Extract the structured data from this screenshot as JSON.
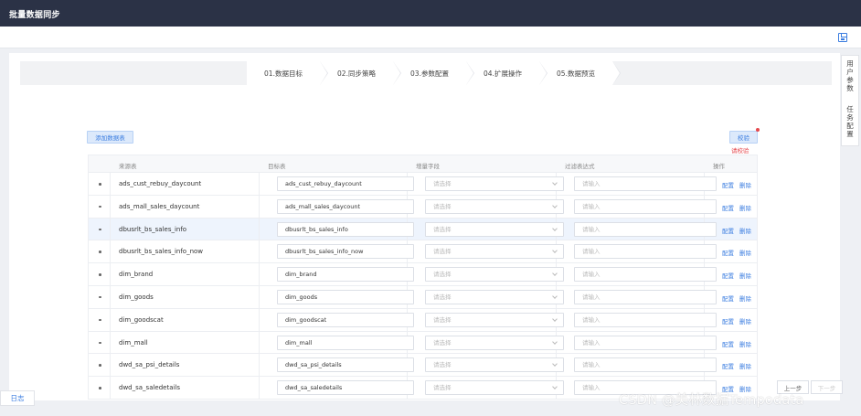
{
  "header": {
    "title": "批量数据同步"
  },
  "steps": [
    "01.数据目标",
    "02.同步策略",
    "03.参数配置",
    "04.扩展操作",
    "05.数据预览"
  ],
  "toolbar": {
    "add_label": "添加数据表",
    "check_label": "校验",
    "check_warning": "请校验"
  },
  "table": {
    "headers": {
      "source": "来源表",
      "target": "目标表",
      "increment": "增量字段",
      "filter": "过滤表达式",
      "ops": "操作"
    },
    "select_placeholder": "请选择",
    "input_placeholder": "请输入",
    "op_config": "配置",
    "op_delete": "删除",
    "rows": [
      {
        "source": "ads_cust_rebuy_daycount",
        "target": "ads_cust_rebuy_daycount"
      },
      {
        "source": "ads_mall_sales_daycount",
        "target": "ads_mall_sales_daycount"
      },
      {
        "source": "dbusrlt_bs_sales_info",
        "target": "dbusrlt_bs_sales_info"
      },
      {
        "source": "dbusrlt_bs_sales_info_now",
        "target": "dbusrlt_bs_sales_info_now"
      },
      {
        "source": "dim_brand",
        "target": "dim_brand"
      },
      {
        "source": "dim_goods",
        "target": "dim_goods"
      },
      {
        "source": "dim_goodscat",
        "target": "dim_goodscat"
      },
      {
        "source": "dim_mall",
        "target": "dim_mall"
      },
      {
        "source": "dwd_sa_psi_details",
        "target": "dwd_sa_psi_details"
      },
      {
        "source": "dwd_sa_saledetails",
        "target": "dwd_sa_saledetails"
      }
    ]
  },
  "right_tabs": [
    "用户参数",
    "任务配置"
  ],
  "log_tab": "日志",
  "pager": {
    "prev": "上一步",
    "next": "下一步"
  },
  "watermark": "CSDN @美林数据Tempodata",
  "colors": {
    "topbar": "#2b3246",
    "accent": "#3b7de0",
    "warning": "#e5484d"
  }
}
